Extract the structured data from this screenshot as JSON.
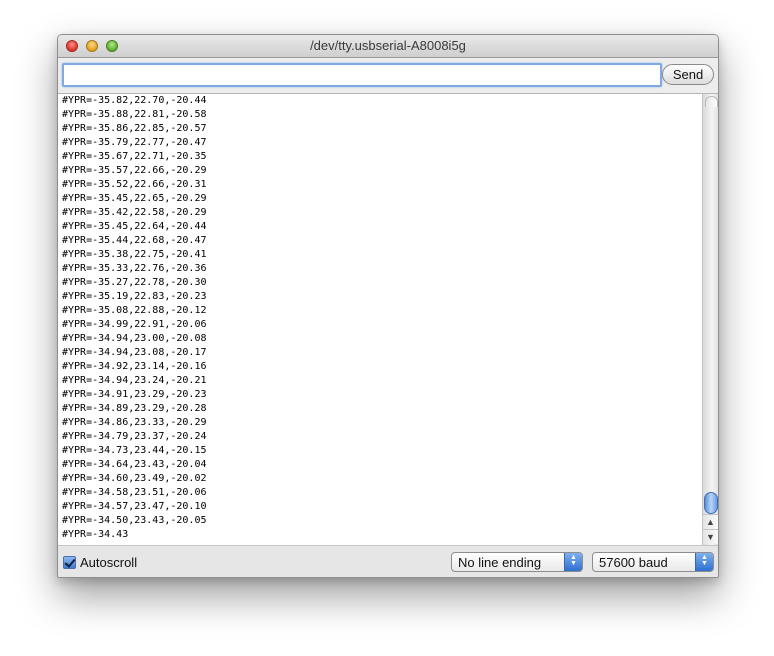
{
  "window": {
    "title": "/dev/tty.usbserial-A8008i5g"
  },
  "toolbar": {
    "input_value": "",
    "send_label": "Send"
  },
  "output": {
    "lines": [
      "#YPR=-35.82,22.70,-20.44",
      "#YPR=-35.88,22.81,-20.58",
      "#YPR=-35.86,22.85,-20.57",
      "#YPR=-35.79,22.77,-20.47",
      "#YPR=-35.67,22.71,-20.35",
      "#YPR=-35.57,22.66,-20.29",
      "#YPR=-35.52,22.66,-20.31",
      "#YPR=-35.45,22.65,-20.29",
      "#YPR=-35.42,22.58,-20.29",
      "#YPR=-35.45,22.64,-20.44",
      "#YPR=-35.44,22.68,-20.47",
      "#YPR=-35.38,22.75,-20.41",
      "#YPR=-35.33,22.76,-20.36",
      "#YPR=-35.27,22.78,-20.30",
      "#YPR=-35.19,22.83,-20.23",
      "#YPR=-35.08,22.88,-20.12",
      "#YPR=-34.99,22.91,-20.06",
      "#YPR=-34.94,23.00,-20.08",
      "#YPR=-34.94,23.08,-20.17",
      "#YPR=-34.92,23.14,-20.16",
      "#YPR=-34.94,23.24,-20.21",
      "#YPR=-34.91,23.29,-20.23",
      "#YPR=-34.89,23.29,-20.28",
      "#YPR=-34.86,23.33,-20.29",
      "#YPR=-34.79,23.37,-20.24",
      "#YPR=-34.73,23.44,-20.15",
      "#YPR=-34.64,23.43,-20.04",
      "#YPR=-34.60,23.49,-20.02",
      "#YPR=-34.58,23.51,-20.06",
      "#YPR=-34.57,23.47,-20.10",
      "#YPR=-34.50,23.43,-20.05",
      "#YPR=-34.43"
    ]
  },
  "statusbar": {
    "autoscroll_label": "Autoscroll",
    "autoscroll_checked": true,
    "line_ending": "No line ending",
    "baud_rate": "57600 baud"
  },
  "icons": {
    "close": "close-button-icon",
    "minimize": "minimize-button-icon",
    "zoom": "zoom-button-icon",
    "scroll_up": "arrow-up-icon",
    "scroll_down": "arrow-down-icon",
    "select_arrows": "up-down-chevron-icon"
  },
  "colors": {
    "accent": "#3e7bd4",
    "traffic_close": "#d9362c",
    "traffic_minimize": "#e0a11d",
    "traffic_zoom": "#5fae2f"
  }
}
